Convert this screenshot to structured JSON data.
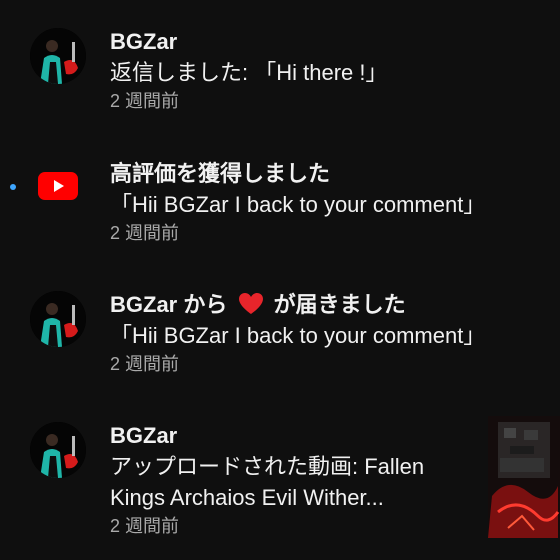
{
  "notifications": [
    {
      "author": "BGZar",
      "message": "返信しました: 「Hi there !」",
      "time": "2 週間前"
    },
    {
      "headline": "高評価を獲得しました",
      "quote": "「Hii BGZar I back to your comment」",
      "time": "2 週間前"
    },
    {
      "author": "BGZar",
      "prefix_suffix_1": "から",
      "prefix_suffix_2": "が届きました",
      "quote": "「Hii BGZar I back to your comment」",
      "time": "2 週間前"
    },
    {
      "author": "BGZar",
      "line1": "アップロードされた動画: Fallen",
      "line2": "Kings Archaios Evil Wither...",
      "time": "2 週間前"
    }
  ],
  "colors": {
    "background": "#0f0f0f",
    "unread_dot": "#3ea6ff",
    "youtube_red": "#ff0000",
    "secondary_text": "#aaaaaa"
  },
  "icons": [
    "avatar",
    "youtube-logo-icon",
    "heart-icon",
    "video-thumbnail"
  ]
}
